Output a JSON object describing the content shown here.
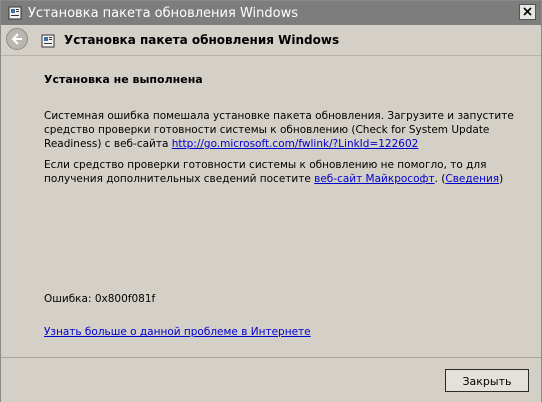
{
  "window": {
    "title": "Установка пакета обновления Windows"
  },
  "nav": {
    "title": "Установка пакета обновления Windows"
  },
  "content": {
    "heading": "Установка не выполнена",
    "p1_text": "Системная ошибка помешала установке пакета обновления. Загрузите и запустите средство проверки готовности системы к обновлению (Check for System Update Readiness) с веб-сайта ",
    "p1_link": "http://go.microsoft.com/fwlink/?LinkId=122602",
    "p2_text": "Если средство проверки готовности системы к обновлению не помогло, то для получения дополнительных сведений посетите ",
    "p2_link": "веб-сайт Майкрософт",
    "p2_mid": ". (",
    "p2_link2": "Сведения",
    "p2_end": ")",
    "error": "Ошибка: 0x800f081f",
    "learn_more": "Узнать больше о данной проблеме в Интернете"
  },
  "footer": {
    "close_label": "Закрыть"
  },
  "icons": {
    "title": "package-icon",
    "nav": "package-icon",
    "back": "back-arrow-icon",
    "close": "close-icon"
  }
}
